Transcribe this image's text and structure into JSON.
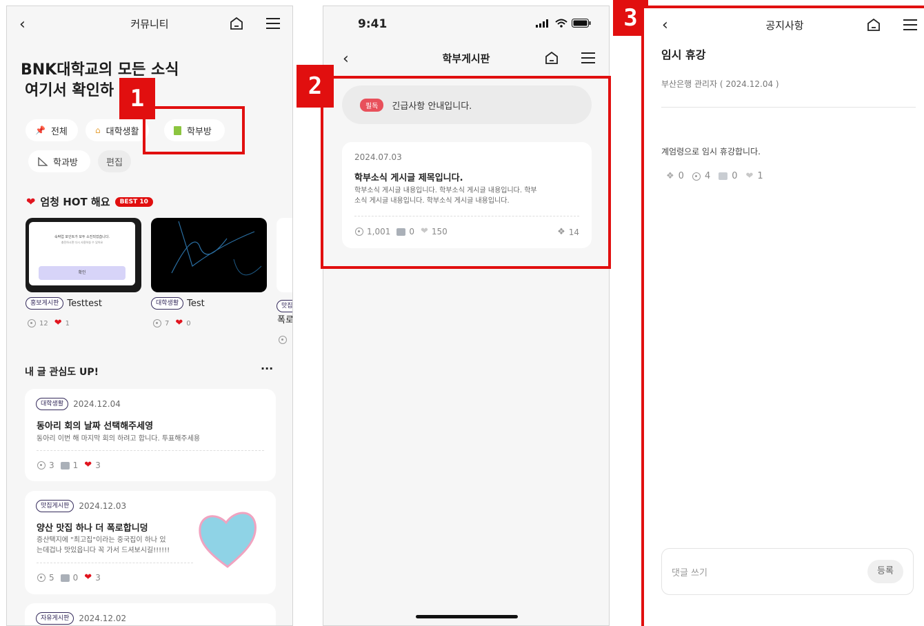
{
  "badges": [
    "1",
    "2",
    "3"
  ],
  "panel1": {
    "header_title": "커뮤니티",
    "headline_line1": "BNK대학교의 모든 소식",
    "headline_line2": "여기서 확인하",
    "chips": [
      {
        "label": "전체",
        "icon": "pin-icon"
      },
      {
        "label": "대학생활",
        "icon": "house-icon"
      },
      {
        "label": "학부방",
        "icon": "book-icon"
      },
      {
        "label": "학과방",
        "icon": "ruler-icon"
      },
      {
        "label": "편집",
        "icon": ""
      }
    ],
    "hot_title": "엄청 HOT 해요",
    "hot_badge": "BEST 10",
    "hot_cards": [
      {
        "tag": "홍보게시판",
        "title": "Testtest",
        "views": "12",
        "likes": "1",
        "thumb_text1": "숙박업 포인트가 모두 소진되었습니다.",
        "thumb_text2": "충전하시면 다시 사용하실 수 있어요",
        "thumb_button": "확인"
      },
      {
        "tag": "대학생활",
        "title": "Test",
        "views": "7",
        "likes": "0"
      },
      {
        "tag": "맛집",
        "title": "폭로"
      }
    ],
    "interest_title": "내 글 관심도 UP!",
    "more": "···",
    "posts": [
      {
        "tag": "대학생활",
        "date": "2024.12.04",
        "title": "동아리 회의 날짜 선택해주세영",
        "body": "동아리 이번 해 마지막 회의 하려고 합니다. 투표해주세용",
        "views": "3",
        "comments": "1",
        "likes": "3"
      },
      {
        "tag": "맛집게시판",
        "date": "2024.12.03",
        "title": "양산 맛집 하나 더 폭로합니덩",
        "body_line1": "증산택지에 \"최고집\"이라는 중국집이 하나 있",
        "body_line2": "는데겁나 맛있읍니다 꼭 가서 드셔보시길!!!!!!",
        "views": "5",
        "comments": "0",
        "likes": "3"
      },
      {
        "tag": "자유게시판",
        "date": "2024.12.02"
      }
    ]
  },
  "panel2": {
    "status_time": "9:41",
    "header_title": "학부게시판",
    "notice_badge": "필독",
    "notice_text": "긴급사항 안내입니다.",
    "post": {
      "date": "2024.07.03",
      "title": "학부소식 게시글 제목입니다.",
      "body_line1": "학부소식 게시글 내용입니다. 학부소식 게시글 내용입니다. 학부",
      "body_line2": "소식 게시글 내용입니다. 학부소식 게시글 내용입니다.",
      "views": "1,001",
      "comments": "0",
      "likes": "150",
      "attachments": "14"
    }
  },
  "panel3": {
    "header_title": "공지사항",
    "title": "임시 휴강",
    "meta": "부산은행 관리자 ( 2024.12.04 )",
    "body": "계엄령으로 임시 휴강합니다.",
    "attachments": "0",
    "views": "4",
    "comments": "0",
    "likes": "1",
    "comment_placeholder": "댓글 쓰기",
    "submit": "등록"
  },
  "colors": {
    "accent_red": "#e10f0f",
    "navy": "#33295a",
    "heart_red": "#e1141e"
  }
}
